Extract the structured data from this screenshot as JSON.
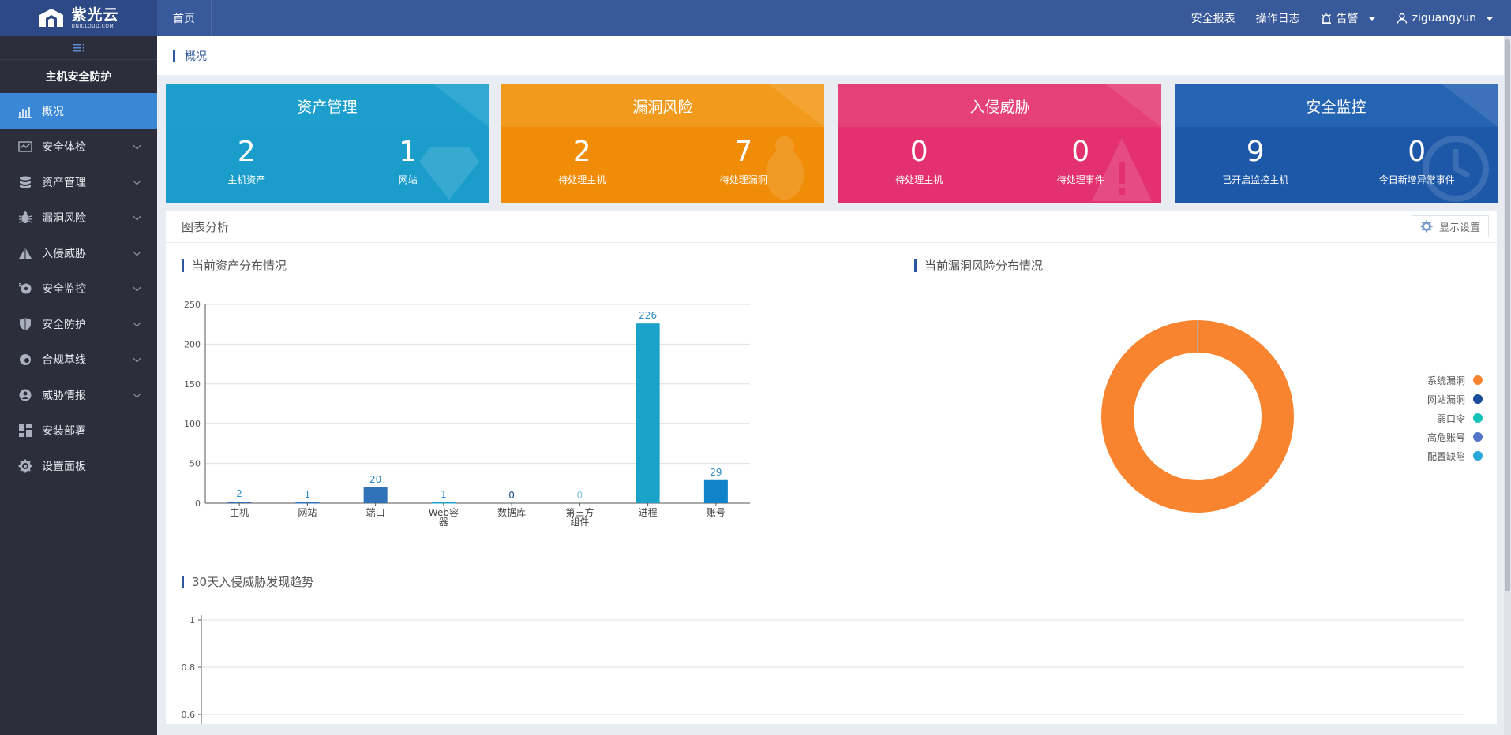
{
  "brand": {
    "name_cn": "紫光云",
    "name_en": "UNICLOUD.COM"
  },
  "topbar": {
    "home": "首页",
    "security_report": "安全报表",
    "operation_log": "操作日志",
    "alerts": "告警",
    "user": "ziguangyun"
  },
  "sidebar": {
    "title": "主机安全防护",
    "items": [
      {
        "label": "概况",
        "icon": "dashboard-icon",
        "active": true
      },
      {
        "label": "安全体检",
        "icon": "checkup-icon"
      },
      {
        "label": "资产管理",
        "icon": "database-icon"
      },
      {
        "label": "漏洞风险",
        "icon": "bug-icon"
      },
      {
        "label": "入侵威胁",
        "icon": "warning-triangle-icon"
      },
      {
        "label": "安全监控",
        "icon": "monitor-icon"
      },
      {
        "label": "安全防护",
        "icon": "shield-icon"
      },
      {
        "label": "合规基线",
        "icon": "baseline-icon"
      },
      {
        "label": "威胁情报",
        "icon": "intel-icon"
      },
      {
        "label": "安装部署",
        "icon": "deploy-icon"
      },
      {
        "label": "设置面板",
        "icon": "gear-icon"
      }
    ]
  },
  "breadcrumb": {
    "current": "概况"
  },
  "cards": [
    {
      "title": "资产管理",
      "color": "#1a9dcb",
      "head_color": "#1c9fcd",
      "stats": [
        {
          "value": "2",
          "label": "主机资产"
        },
        {
          "value": "1",
          "label": "网站"
        }
      ]
    },
    {
      "title": "漏洞风险",
      "color": "#f08c07",
      "head_color": "#f29a1c",
      "stats": [
        {
          "value": "2",
          "label": "待处理主机"
        },
        {
          "value": "7",
          "label": "待处理漏洞"
        }
      ]
    },
    {
      "title": "入侵威胁",
      "color": "#e3306f",
      "head_color": "#e64079",
      "stats": [
        {
          "value": "0",
          "label": "待处理主机"
        },
        {
          "value": "0",
          "label": "待处理事件"
        }
      ]
    },
    {
      "title": "安全监控",
      "color": "#1c57a8",
      "head_color": "#2563b3",
      "stats": [
        {
          "value": "9",
          "label": "已开启监控主机"
        },
        {
          "value": "0",
          "label": "今日新增异常事件"
        }
      ]
    }
  ],
  "panel": {
    "title": "图表分析",
    "settings_label": "显示设置",
    "asset_chart_title": "当前资产分布情况",
    "vuln_chart_title": "当前漏洞风险分布情况",
    "trend_chart_title": "30天入侵威胁发现趋势"
  },
  "chart_data": [
    {
      "type": "bar",
      "categories": [
        "主机",
        "网站",
        "端口",
        "Web容器",
        "数据库",
        "第三方组件",
        "进程",
        "账号"
      ],
      "values": [
        2,
        1,
        20,
        1,
        0,
        0,
        226,
        29
      ],
      "colors": [
        "#2f72b8",
        "#2f72b8",
        "#2f72b8",
        "#1fa3c8",
        "#1fa3c8",
        "#1fa3c8",
        "#1aa2c9",
        "#1183c8"
      ],
      "ylim": [
        0,
        250
      ],
      "yticks": [
        0,
        50,
        100,
        150,
        200,
        250
      ]
    },
    {
      "type": "pie",
      "donut": true,
      "labels": [
        "系统漏洞",
        "网站漏洞",
        "弱口令",
        "高危账号",
        "配置缺陷"
      ],
      "values": [
        7,
        0,
        0,
        0,
        0
      ],
      "colors": [
        "#f88430",
        "#1b4c9b",
        "#14c2b8",
        "#5474c8",
        "#27a8d8"
      ]
    },
    {
      "type": "line",
      "yticks": [
        1,
        0.8,
        0.6
      ],
      "ylim": [
        0,
        1
      ]
    }
  ]
}
